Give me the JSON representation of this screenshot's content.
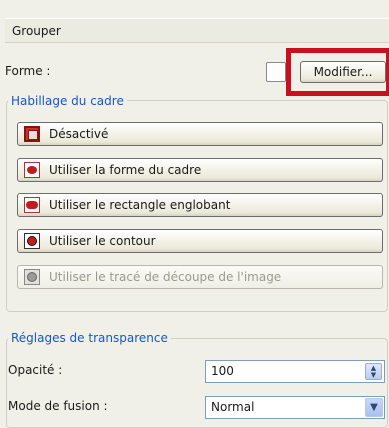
{
  "panel": {
    "group_label": "Grouper",
    "forme_label": "Forme :",
    "modify_label": "Modifier..."
  },
  "wrap": {
    "title": "Habillage du cadre",
    "options": [
      {
        "label": "Désactivé",
        "icon": "wrap-off-icon",
        "enabled": true
      },
      {
        "label": "Utiliser la forme du cadre",
        "icon": "wrap-frame-shape-icon",
        "enabled": true
      },
      {
        "label": "Utiliser le rectangle englobant",
        "icon": "wrap-bounding-box-icon",
        "enabled": true
      },
      {
        "label": "Utiliser le contour",
        "icon": "wrap-contour-icon",
        "enabled": true
      },
      {
        "label": "Utiliser le tracé de découpe de l'image",
        "icon": "wrap-clip-path-icon",
        "enabled": false
      }
    ]
  },
  "transparency": {
    "title": "Réglages de transparence",
    "opacity_label": "Opacité :",
    "opacity_value": "100",
    "blend_label": "Mode de fusion :",
    "blend_value": "Normal"
  },
  "colors": {
    "highlight": "#c8101f",
    "section_title": "#1656c7",
    "panel_bg": "#f1f0e8"
  }
}
